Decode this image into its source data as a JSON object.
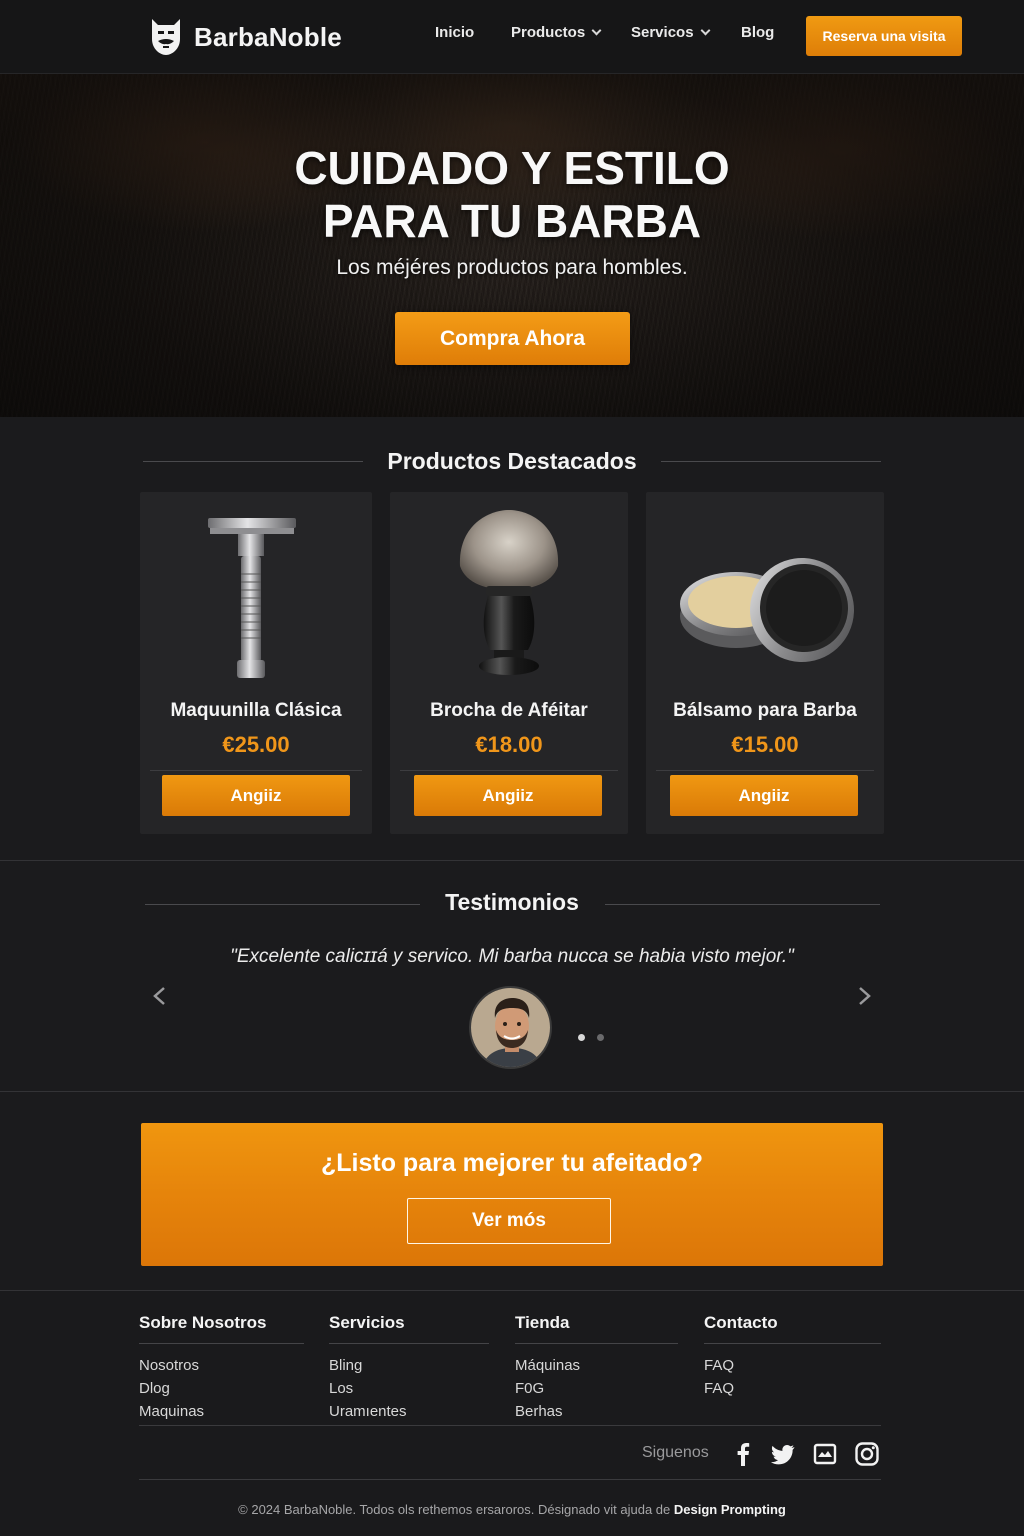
{
  "nav": {
    "brand": "BarbaNoble",
    "links": [
      {
        "label": "Inicio",
        "has_dropdown": false
      },
      {
        "label": "Productos",
        "has_dropdown": true
      },
      {
        "label": "Servicos",
        "has_dropdown": true
      },
      {
        "label": "Blog",
        "has_dropdown": false
      }
    ],
    "cta_label": "Reserva una visita"
  },
  "hero": {
    "title_line1": "CUIDADO Y ESTILO",
    "title_line2": "PARA TU BARBA",
    "subtitle": "Los méjéres productos para hombles.",
    "button_label": "Compra Ahora"
  },
  "featured": {
    "title": "Productos Destacados",
    "products": [
      {
        "name": "Maquunilla Clásica",
        "price": "€25.00",
        "button": "Anɡiiz",
        "icon": "razor-icon"
      },
      {
        "name": "Brocha de Aféitar",
        "price": "€18.00",
        "button": "Anɡiiz",
        "icon": "shaving-brush-icon"
      },
      {
        "name": "Bálsamo para Barba",
        "price": "€15.00",
        "button": "Anɡiiz",
        "icon": "balm-tin-icon"
      }
    ]
  },
  "testimonials": {
    "title": "Testimonios",
    "quote": "\"Excelente calicɪɪá y servico. Mi barba nucca se habia visto mejor.\"",
    "active_slide": 1,
    "slide_count": 2
  },
  "cta": {
    "title": "¿Listo para mejorer tu afeitado?",
    "button_label": "Ver mós"
  },
  "footer": {
    "columns": [
      {
        "title": "Sobre Nosotros",
        "links": [
          "Nosotros",
          "Dlog",
          "Maquinas"
        ]
      },
      {
        "title": "Servicios",
        "links": [
          "Bling",
          "Los",
          "Uramıentes"
        ]
      },
      {
        "title": "Tienda",
        "links": [
          "Máquinas",
          "F0G",
          "Berhas"
        ]
      },
      {
        "title": "Contacto",
        "links": [
          "FAQ",
          "FAQ"
        ]
      }
    ],
    "follow_label": "Siguenos",
    "social_icons": [
      "facebook-icon",
      "twitter-icon",
      "mail-icon",
      "instagram-icon"
    ],
    "copyright_text": "© 2024 BarbaNoble. Todos ols rethemos ersaroros. Désignado vit ajuda de",
    "copyright_brand": "Design Prompting"
  },
  "colors": {
    "accent": "#f0961a",
    "background": "#1b1b1d",
    "card": "#252527"
  }
}
